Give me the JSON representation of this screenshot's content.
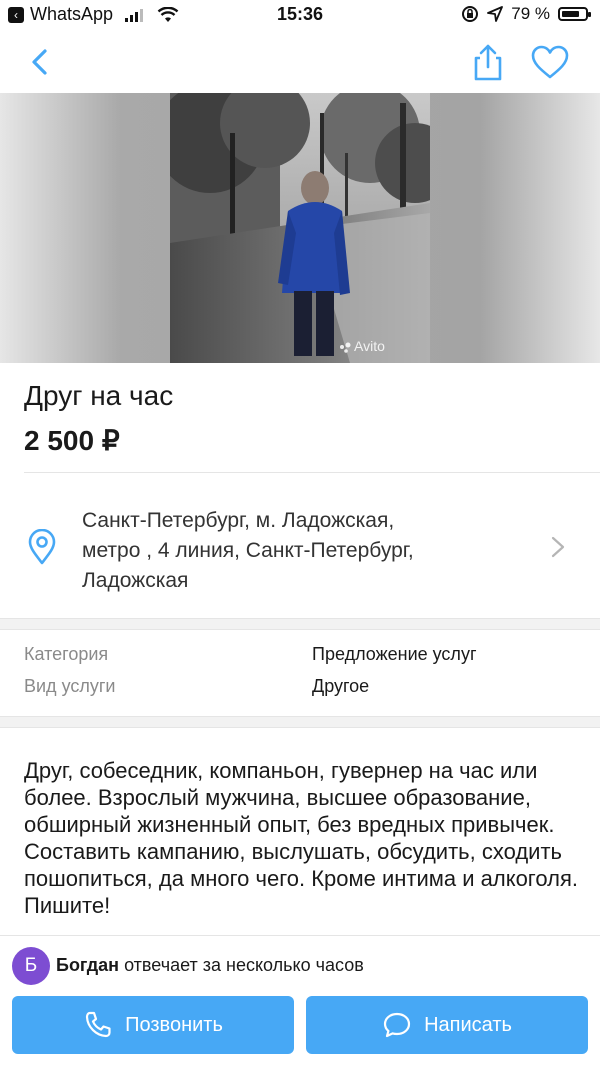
{
  "status_bar": {
    "app": "WhatsApp",
    "time": "15:36",
    "battery_pct": "79 %",
    "battery_level": 0.79
  },
  "colors": {
    "accent": "#47a8f5",
    "avatar_bg": "#7d4dd2"
  },
  "nav": {
    "icons": [
      "back-chevron-icon",
      "share-icon",
      "heart-icon"
    ]
  },
  "listing": {
    "title": "Друг на час",
    "price": "2 500 ₽",
    "photo_watermark": "Avito"
  },
  "address": {
    "lines": [
      "Санкт-Петербург, м. Ладожская,",
      "метро , 4 линия, Санкт-Петербург,",
      "Ладожская"
    ]
  },
  "params": [
    {
      "label": "Категория",
      "value": "Предложение услуг"
    },
    {
      "label": "Вид услуги",
      "value": "Другое"
    }
  ],
  "description": "Друг, собеседник, компаньон, гувернер на час или более. Взрослый мужчина, высшее образование, обширный жизненный опыт, без вредных привычек. Составить кампанию, выслушать, обсудить, сходить пошопиться, да много чего. Кроме интима и алкоголя. Пишите!",
  "seller": {
    "initial": "Б",
    "name": "Богдан",
    "response": " отвечает за несколько часов"
  },
  "actions": {
    "call_label": "Позвонить",
    "message_label": "Написать"
  }
}
